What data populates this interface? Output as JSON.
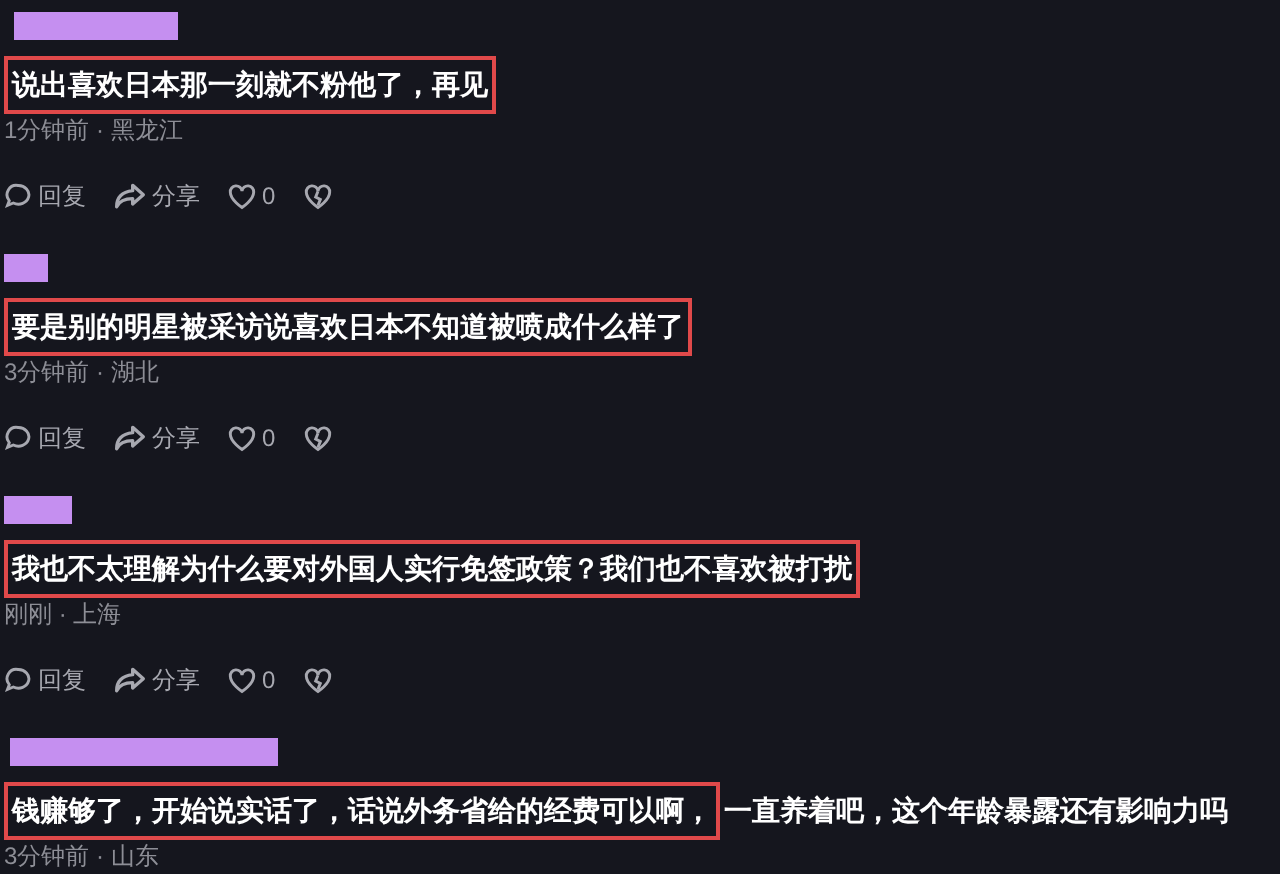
{
  "comments": [
    {
      "segments": [
        {
          "text": "说出喜欢日本那一刻就不粉他了，再见",
          "highlighted": true
        }
      ],
      "meta": "1分钟前 · 黑龙江",
      "actions": {
        "reply": "回复",
        "share": "分享",
        "likes": "0"
      }
    },
    {
      "segments": [
        {
          "text": "要是别的明星被采访说喜欢日本不知道被喷成什么样了",
          "highlighted": true
        }
      ],
      "meta": "3分钟前 · 湖北",
      "actions": {
        "reply": "回复",
        "share": "分享",
        "likes": "0"
      }
    },
    {
      "segments": [
        {
          "text": "我也不太理解为什么要对外国人实行免签政策？我们也不喜欢被打扰",
          "highlighted": true
        }
      ],
      "meta": "刚刚 · 上海",
      "actions": {
        "reply": "回复",
        "share": "分享",
        "likes": "0"
      }
    },
    {
      "segments": [
        {
          "text": "钱赚够了，开始说实话了，话说外务省给的经费可以啊，",
          "highlighted": true
        },
        {
          "text": "一直养着吧，这个年龄暴露还有影响力吗",
          "highlighted": false
        }
      ],
      "meta": "3分钟前 · 山东"
    }
  ]
}
